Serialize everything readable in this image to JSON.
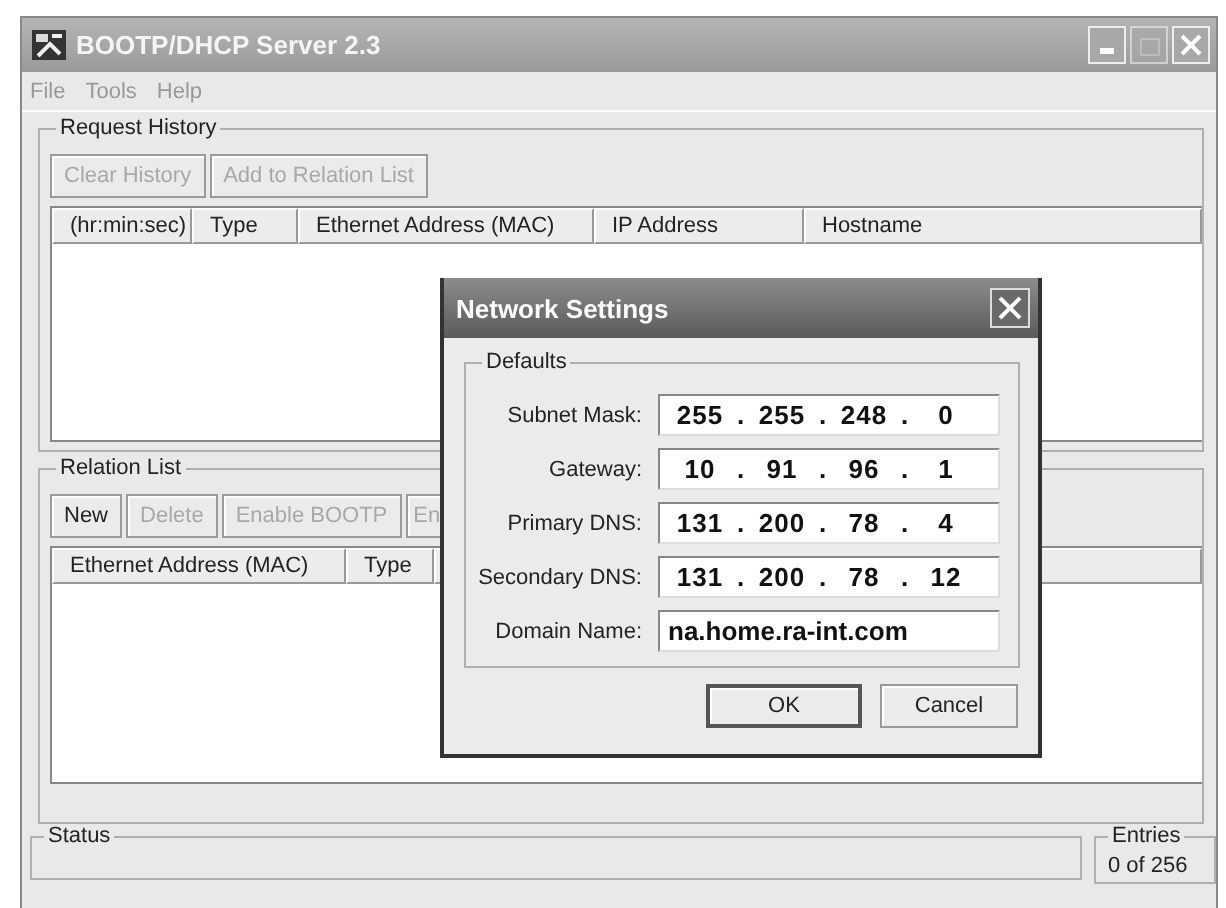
{
  "window": {
    "title": "BOOTP/DHCP Server 2.3"
  },
  "menu": [
    "File",
    "Tools",
    "Help"
  ],
  "request_history": {
    "title": "Request History",
    "buttons": [
      {
        "label": "Clear History",
        "disabled": true
      },
      {
        "label": "Add to Relation List",
        "disabled": true
      }
    ],
    "columns": [
      "(hr:min:sec)",
      "Type",
      "Ethernet Address (MAC)",
      "IP Address",
      "Hostname"
    ]
  },
  "relation_list": {
    "title": "Relation List",
    "buttons": [
      {
        "label": "New",
        "disabled": false
      },
      {
        "label": "Delete",
        "disabled": true
      },
      {
        "label": "Enable BOOTP",
        "disabled": true
      },
      {
        "label": "En",
        "disabled": true
      }
    ],
    "columns": [
      "Ethernet Address (MAC)",
      "Type"
    ]
  },
  "status": {
    "title": "Status"
  },
  "entries": {
    "title": "Entries",
    "value": "0 of 256"
  },
  "dialog": {
    "title": "Network Settings",
    "group": "Defaults",
    "fields": [
      {
        "label": "Subnet Mask:",
        "kind": "ip",
        "separator": ".",
        "octets": [
          "255",
          "255",
          "248",
          "0"
        ]
      },
      {
        "label": "Gateway:",
        "kind": "ip",
        "separator": ".",
        "octets": [
          "10",
          "91",
          "96",
          "1"
        ]
      },
      {
        "label": "Primary DNS:",
        "kind": "ip",
        "separator": ".",
        "octets": [
          "131",
          "200",
          "78",
          "4"
        ]
      },
      {
        "label": "Secondary DNS:",
        "kind": "ip",
        "separator": ".",
        "octets": [
          "131",
          "200",
          "78",
          "12"
        ]
      },
      {
        "label": "Domain Name:",
        "kind": "text",
        "value": "na.home.ra-int.com"
      }
    ],
    "buttons": [
      {
        "label": "OK",
        "default": true
      },
      {
        "label": "Cancel",
        "default": false
      }
    ]
  }
}
